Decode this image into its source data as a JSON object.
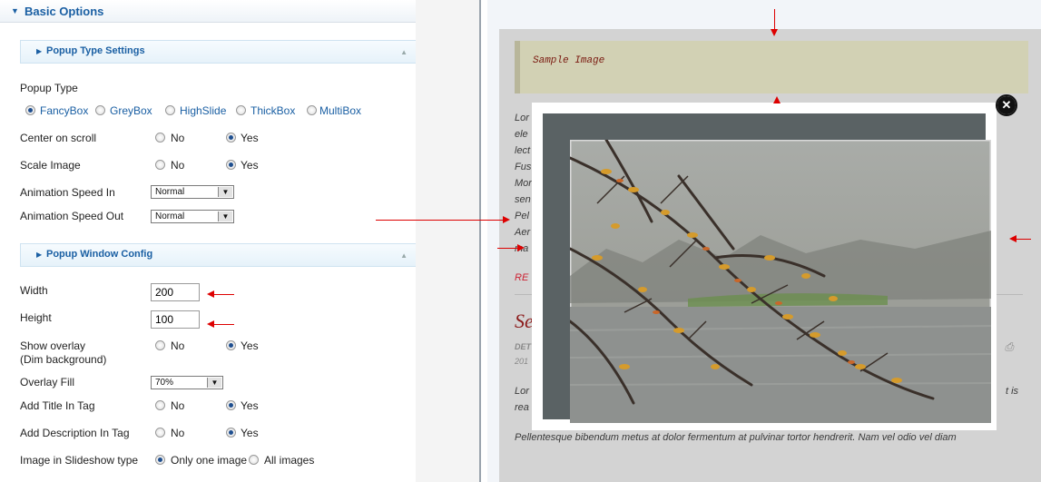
{
  "basic_options": {
    "title": "Basic Options",
    "popup_type_settings": {
      "title": "Popup Type Settings",
      "popup_type_label": "Popup Type",
      "popup_types": [
        "FancyBox",
        "GreyBox",
        "HighSlide",
        "ThickBox",
        "MultiBox"
      ],
      "selected_popup_type": "FancyBox",
      "center_on_scroll": {
        "label": "Center on scroll",
        "options": [
          "No",
          "Yes"
        ],
        "selected": "Yes"
      },
      "scale_image": {
        "label": "Scale Image",
        "options": [
          "No",
          "Yes"
        ],
        "selected": "Yes"
      },
      "animation_speed_in": {
        "label": "Animation Speed In",
        "value": "Normal"
      },
      "animation_speed_out": {
        "label": "Animation Speed Out",
        "value": "Normal"
      }
    },
    "popup_window_config": {
      "title": "Popup Window Config",
      "width": {
        "label": "Width",
        "value": "200"
      },
      "height": {
        "label": "Height",
        "value": "100"
      },
      "show_overlay": {
        "label_line1": "Show overlay",
        "label_line2": "(Dim background)",
        "options": [
          "No",
          "Yes"
        ],
        "selected": "Yes"
      },
      "overlay_fill": {
        "label": "Overlay Fill",
        "value": "70%"
      },
      "add_title_in_tag": {
        "label": "Add Title In Tag",
        "options": [
          "No",
          "Yes"
        ],
        "selected": "Yes"
      },
      "add_description_in_tag": {
        "label": "Add Description In Tag",
        "options": [
          "No",
          "Yes"
        ],
        "selected": "Yes"
      },
      "image_in_slideshow_type": {
        "label": "Image in Slideshow type",
        "options": [
          "Only one image",
          "All images"
        ],
        "selected": "Only one image"
      }
    }
  },
  "preview": {
    "code_block_text": "Sample Image",
    "body_fragments": [
      "Lor",
      "ele",
      "lect",
      "Fus",
      "Mor",
      "sen",
      "Pel",
      "Aer",
      "ma"
    ],
    "read_more_fragment": "RE",
    "heading_fragment": "Se",
    "meta_fragment_1": "DET",
    "meta_fragment_2": "201",
    "body2_left_1": "Lor",
    "body2_left_2": "rea",
    "body2_right": "t is",
    "footer_line": "Pellentesque bibendum metus at dolor fermentum at pulvinar tortor hendrerit. Nam vel odio vel diam"
  },
  "colors": {
    "accent_blue": "#1a5fa3",
    "annotation_red": "#dd0000",
    "popup_mat": "#5a6264"
  },
  "icons": {
    "close": "close-icon",
    "print": "print-icon"
  }
}
